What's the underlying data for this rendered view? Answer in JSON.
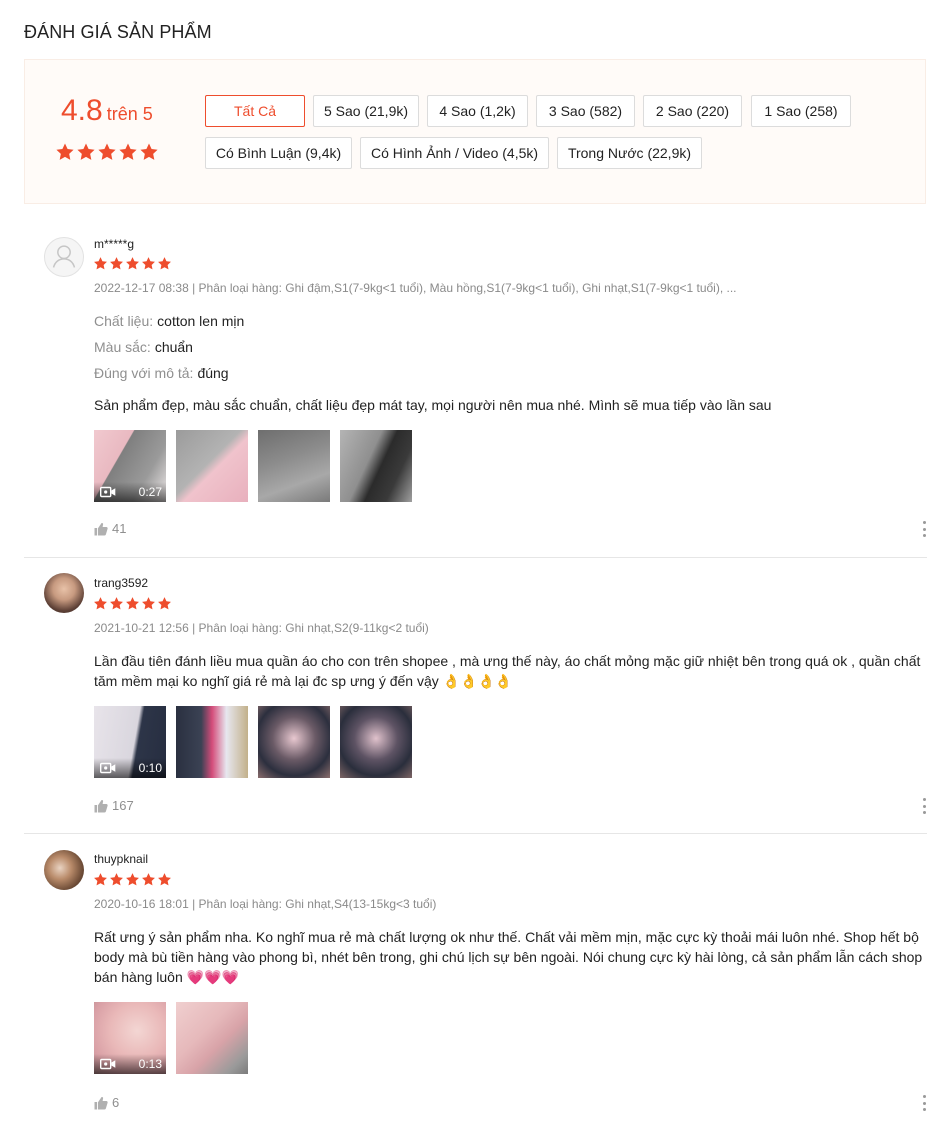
{
  "title": "ĐÁNH GIÁ SẢN PHẨM",
  "overview": {
    "score": "4.8",
    "out_of": "trên 5",
    "rating": 5,
    "filters": [
      {
        "label": "Tất Cả",
        "active": true
      },
      {
        "label": "5 Sao (21,9k)",
        "active": false
      },
      {
        "label": "4 Sao (1,2k)",
        "active": false
      },
      {
        "label": "3 Sao (582)",
        "active": false
      },
      {
        "label": "2 Sao (220)",
        "active": false
      },
      {
        "label": "1 Sao (258)",
        "active": false
      },
      {
        "label": "Có Bình Luận (9,4k)",
        "active": false
      },
      {
        "label": "Có Hình Ảnh / Video (4,5k)",
        "active": false
      },
      {
        "label": "Trong Nước (22,9k)",
        "active": false
      }
    ]
  },
  "colors": {
    "accent": "#ee4d2d",
    "star": "#ee4d2d",
    "muted": "#8f8f8f"
  },
  "reviews": [
    {
      "username": "m*****g",
      "rating": 5,
      "meta": "2022-12-17 08:38 | Phân loại hàng: Ghi đậm,S1(7-9kg<1 tuổi), Màu hồng,S1(7-9kg<1 tuổi), Ghi nhạt,S1(7-9kg<1 tuổi), ...",
      "attributes": [
        {
          "key": "Chất liệu:",
          "value": "cotton len mịn"
        },
        {
          "key": "Màu sắc:",
          "value": "chuẩn"
        },
        {
          "key": "Đúng với mô tả:",
          "value": "đúng"
        }
      ],
      "comment": "Sản phẩm đẹp, màu sắc chuẩn, chất liệu đẹp mát tay, mọi người nên mua nhé. Mình sẽ mua tiếp vào lần sau",
      "video_duration": "0:27",
      "likes": "41"
    },
    {
      "username": "trang3592",
      "rating": 5,
      "meta": "2021-10-21 12:56 | Phân loại hàng: Ghi nhạt,S2(9-11kg<2 tuổi)",
      "attributes": [],
      "comment": "Lần đầu tiên đánh liều mua quần áo cho con trên shopee , mà ưng thế này, áo chất mỏng mặc giữ nhiệt bên trong quá ok , quần chất tăm mềm mại ko nghĩ giá rẻ mà lại đc sp ưng ý đến vậy 👌👌👌👌",
      "video_duration": "0:10",
      "likes": "167"
    },
    {
      "username": "thuypknail",
      "rating": 5,
      "meta": "2020-10-16 18:01 | Phân loại hàng: Ghi nhạt,S4(13-15kg<3 tuổi)",
      "attributes": [],
      "comment": "Rất ưng ý sản phẩm nha. Ko nghĩ mua rẻ mà chất lượng ok như thế. Chất vải mềm mịn, mặc cực kỳ thoải mái luôn nhé. Shop hết bộ body mà bù tiền hàng vào phong bì, nhét bên trong, ghi chú lịch sự bên ngoài. Nói chung cực kỳ hài lòng, cả sản phẩm lẫn cách shop bán hàng luôn 💗💗💗",
      "video_duration": "0:13",
      "likes": "6"
    }
  ]
}
